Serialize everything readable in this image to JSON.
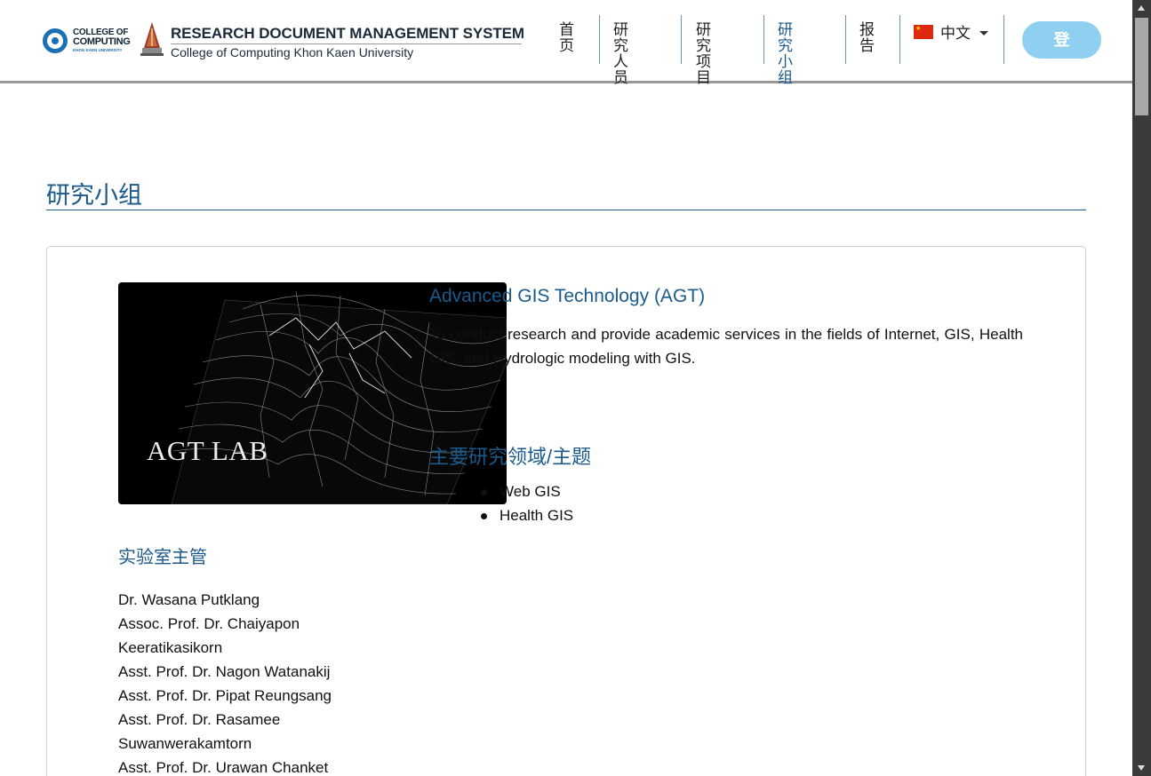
{
  "header": {
    "college_logo_line1": "COLLEGE OF",
    "college_logo_line2": "COMPUTING",
    "college_logo_line3": "KHON KAEN UNIVERSITY",
    "system_title": "RESEARCH DOCUMENT MANAGEMENT SYSTEM",
    "system_subtitle": "College of Computing Khon Kaen University",
    "nav": [
      {
        "label_line1": "首",
        "label_line2": "页"
      },
      {
        "label_line1": "研究人",
        "label_line2": "员"
      },
      {
        "label_line1": "研究项",
        "label_line2": "目"
      },
      {
        "label_line1": "研究小",
        "label_line2": "组"
      },
      {
        "label_line1": "报",
        "label_line2": "告"
      }
    ],
    "active_nav": "研究小组",
    "language": "中文",
    "login_label": "登"
  },
  "page": {
    "title": "研究小组"
  },
  "lab": {
    "image_text": "AGT LAB",
    "title": "Advanced GIS Technology (AGT)",
    "description": "To conduct research and provide academic services in the fields of Internet, GIS, Health GIS, and Hydrologic modeling with GIS.",
    "focus_title": "主要研究领域/主题",
    "focus_areas": [
      "Web GIS",
      "Health GIS"
    ],
    "head_title": "实验室主管",
    "heads": [
      "Dr. Wasana Putklang",
      "Assoc. Prof. Dr. Chaiyapon Keeratikasikorn",
      "Asst. Prof. Dr. Nagon Watanakij",
      "Asst. Prof. Dr. Pipat Reungsang",
      "Asst. Prof. Dr. Rasamee Suwanwerakamtorn",
      "Asst. Prof. Dr. Urawan Chanket"
    ]
  },
  "colors": {
    "accent": "#1a5a8c",
    "login_button": "#8fd0f0",
    "header_rule": "#9a9a9a"
  },
  "icons": {
    "flag": "china-flag-icon",
    "caret": "chevron-down-icon"
  }
}
